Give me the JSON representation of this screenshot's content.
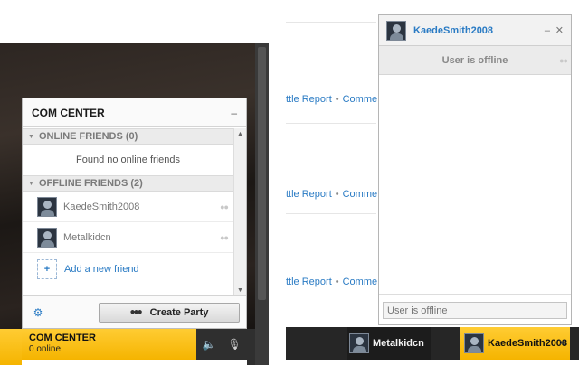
{
  "com_center": {
    "title": "COM CENTER",
    "minimize_glyph": "–",
    "online_section": {
      "label": "ONLINE FRIENDS (0)",
      "empty_message": "Found no online friends"
    },
    "offline_section": {
      "label": "OFFLINE FRIENDS (2)"
    },
    "friends": [
      {
        "name": "KaedeSmith2008",
        "icon": "people-icon"
      },
      {
        "name": "Metalkidcn",
        "icon": "people-icon"
      }
    ],
    "add_friend_label": "Add a new friend",
    "create_party_label": "Create Party"
  },
  "com_bar": {
    "title": "COM CENTER",
    "status": "0 online"
  },
  "feed": {
    "rows": [
      {
        "link1": "ttle Report",
        "separator": "•",
        "link2": "Comme"
      },
      {
        "link1": "ttle Report",
        "separator": "•",
        "link2": "Comme"
      },
      {
        "link1": "ttle Report",
        "separator": "•",
        "link2": "Comme"
      }
    ]
  },
  "chat_window": {
    "contact_name": "KaedeSmith2008",
    "minimize_glyph": "–",
    "close_glyph": "✕",
    "status_text": "User is offline",
    "input_placeholder": "User is offline"
  },
  "taskbar": {
    "items": [
      {
        "name": "Metalkidcn"
      },
      {
        "name": "KaedeSmith2008"
      }
    ],
    "close_glyph": "✕"
  },
  "colors": {
    "accent_yellow": "#f5b400",
    "link_blue": "#2a7bc4",
    "taskbar_dark": "#262626"
  }
}
